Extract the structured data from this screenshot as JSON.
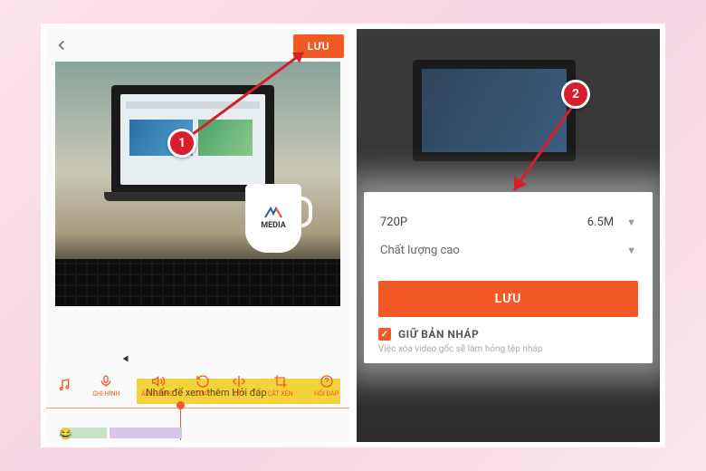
{
  "steps": {
    "one": "1",
    "two": "2"
  },
  "left": {
    "save_label": "LƯU",
    "hint": "Nhấn để xem thêm Hỏi đáp",
    "mug_brand": "MEDIA",
    "toolbar": [
      {
        "icon": "music-icon",
        "label": ""
      },
      {
        "icon": "mic-icon",
        "label": "GHI HÌNH"
      },
      {
        "icon": "volume-icon",
        "label": "ÂM LƯỢNG"
      },
      {
        "icon": "rotate-icon",
        "label": "XOAY"
      },
      {
        "icon": "flip-icon",
        "label": "LẬT"
      },
      {
        "icon": "crop-icon",
        "label": "CẮT XÉN"
      },
      {
        "icon": "help-icon",
        "label": "HỎI ĐÁP"
      }
    ]
  },
  "right": {
    "resolution": "720P",
    "size": "6.5M",
    "quality": "Chất lượng cao",
    "save_label": "LƯU",
    "keep_draft": "GIỮ BẢN NHÁP",
    "draft_checked": true,
    "note": "Việc xóa video gốc sẽ làm hỏng tệp nháp"
  }
}
